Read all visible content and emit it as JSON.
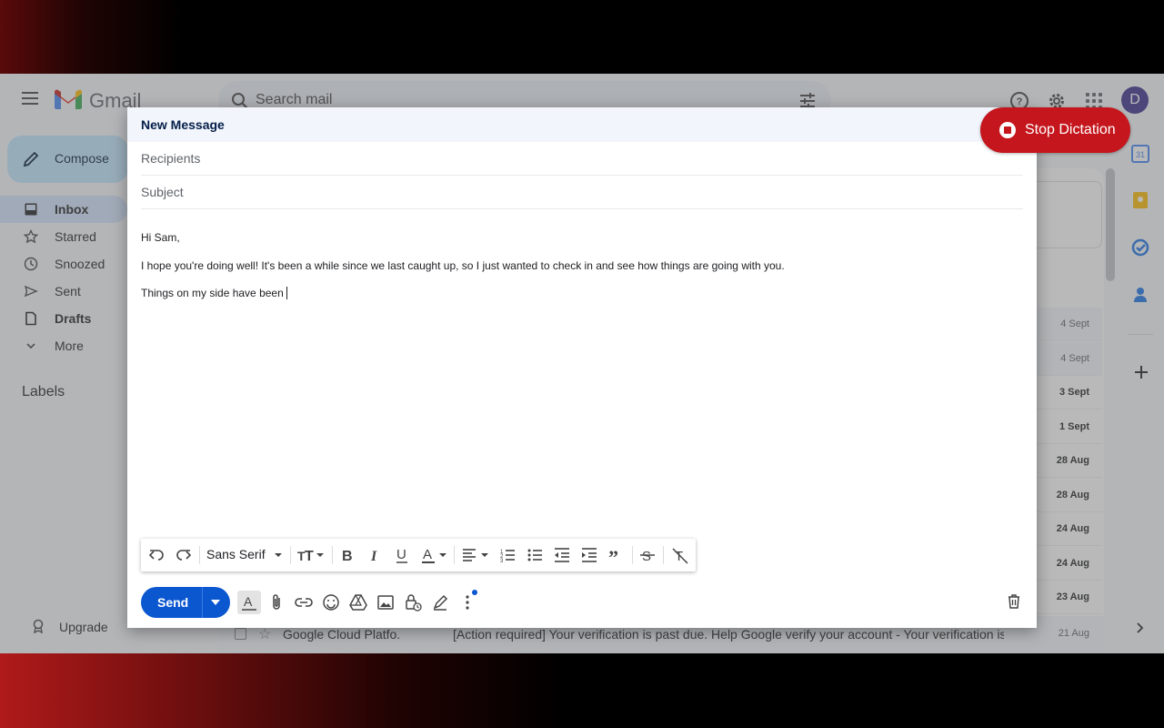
{
  "app": {
    "name": "Gmail",
    "search_placeholder": "Search mail",
    "avatar_initial": "D"
  },
  "sidebar": {
    "compose_label": "Compose",
    "items": [
      {
        "label": "Inbox",
        "icon": "inbox-icon"
      },
      {
        "label": "Starred",
        "icon": "star-icon"
      },
      {
        "label": "Snoozed",
        "icon": "clock-icon"
      },
      {
        "label": "Sent",
        "icon": "send-icon"
      },
      {
        "label": "Drafts",
        "icon": "draft-icon"
      },
      {
        "label": "More",
        "icon": "chevron-down-icon"
      }
    ],
    "labels_header": "Labels",
    "upgrade_label": "Upgrade"
  },
  "email_list": {
    "dates": [
      "4 Sept",
      "4 Sept",
      "3 Sept",
      "1 Sept",
      "28 Aug",
      "28 Aug",
      "24 Aug",
      "24 Aug",
      "23 Aug"
    ],
    "last_row": {
      "sender": "Google Cloud Platfo.",
      "subject": "[Action required] Your verification is past due. Help Google verify your account - Your verification is p...",
      "date": "21 Aug"
    }
  },
  "compose": {
    "title": "New Message",
    "recipients_placeholder": "Recipients",
    "subject_placeholder": "Subject",
    "body": {
      "greeting": "Hi Sam,",
      "line1": "I hope you're doing well! It's been a while since we last caught up, so I just wanted to check in and see how things are going with you.",
      "line2": "Things on my side have been"
    },
    "font": "Sans Serif",
    "send_label": "Send"
  },
  "dictation": {
    "label": "Stop Dictation"
  },
  "colors": {
    "send": "#0b57d0",
    "dictation": "#c4161c",
    "compose_button": "#c2e7ff"
  }
}
